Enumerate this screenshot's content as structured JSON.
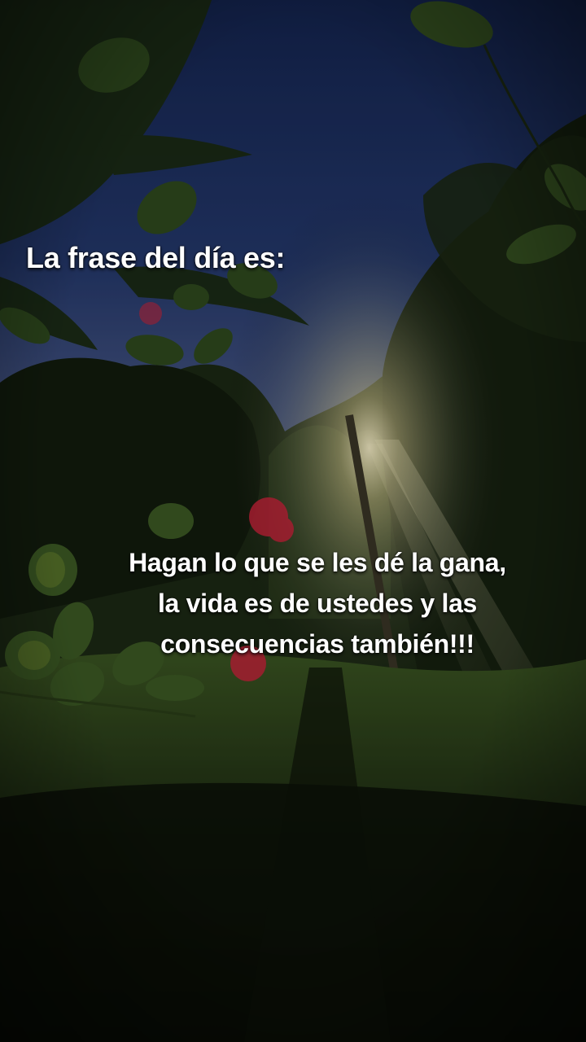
{
  "scene": {
    "description_icon": "garden-sunset-photo",
    "colors": {
      "sky_top": "#1a2d5e",
      "sky_mid": "#3a4f86",
      "sun_glow": "#f3e9b8",
      "foliage_dark": "#101a0c",
      "grass": "#2f4a1c",
      "flower": "#c8243a"
    }
  },
  "caption": {
    "heading": "La frase del día es:",
    "quote_lines": [
      "Hagan lo que se les dé la gana,",
      "la vida es de ustedes y las",
      "consecuencias también!!!"
    ]
  }
}
